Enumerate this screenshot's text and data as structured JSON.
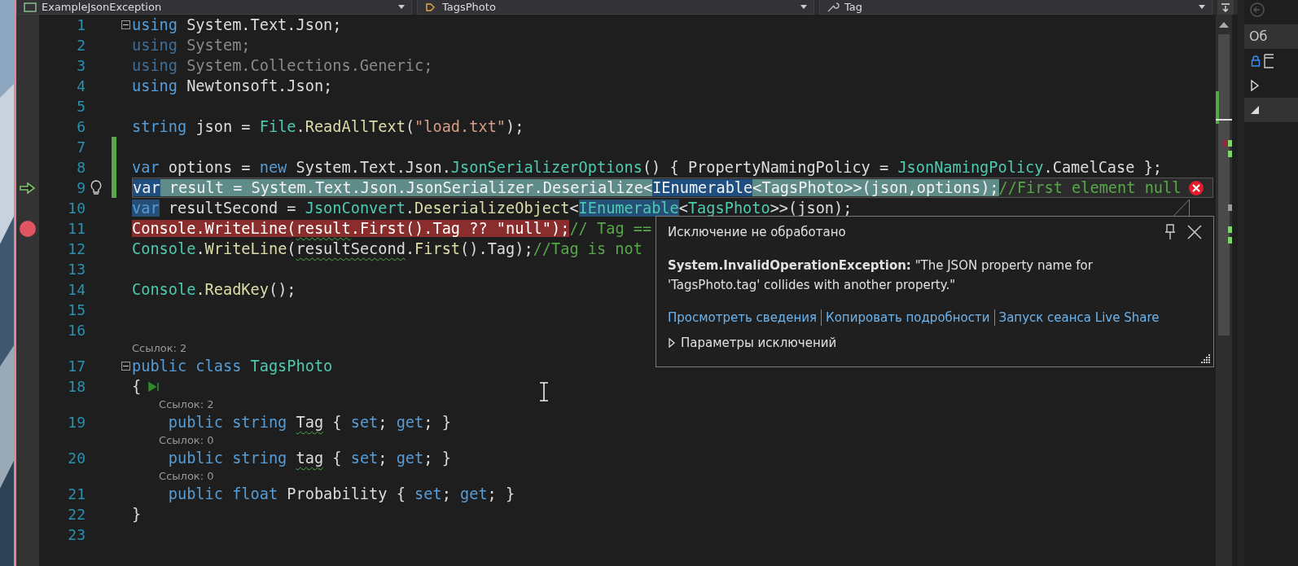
{
  "navigation_bar": [
    {
      "label": "ExampleJsonException",
      "kind": "project"
    },
    {
      "label": "TagsPhoto",
      "kind": "class"
    },
    {
      "label": "Tag",
      "kind": "property"
    }
  ],
  "editor": {
    "lines": [
      {
        "number": "1",
        "collapsible": true,
        "tokens": [
          {
            "t": "using ",
            "kind": "kw"
          },
          {
            "t": "System.Text.Json;",
            "kind": "plain"
          }
        ]
      },
      {
        "number": "2",
        "tokens": [
          {
            "t": "using ",
            "kind": "dimkw"
          },
          {
            "t": "System;",
            "kind": "dim"
          }
        ]
      },
      {
        "number": "3",
        "tokens": [
          {
            "t": "using ",
            "kind": "dimkw"
          },
          {
            "t": "System.Collections.Generic;",
            "kind": "dim"
          }
        ]
      },
      {
        "number": "4",
        "tokens": [
          {
            "t": "using ",
            "kind": "kw"
          },
          {
            "t": "Newtonsoft.Json;",
            "kind": "plain"
          }
        ]
      },
      {
        "number": "5"
      },
      {
        "number": "6",
        "tokens": [
          {
            "t": "string ",
            "kind": "kw"
          },
          {
            "t": "json = ",
            "kind": "plain"
          },
          {
            "t": "File",
            "kind": "type"
          },
          {
            "t": ".",
            "kind": "plain"
          },
          {
            "t": "ReadAllText",
            "kind": "method"
          },
          {
            "t": "(",
            "kind": "plain"
          },
          {
            "t": "\"load.txt\"",
            "kind": "str"
          },
          {
            "t": ");",
            "kind": "plain"
          }
        ]
      },
      {
        "number": "7",
        "changed": true
      },
      {
        "number": "8",
        "changed": true,
        "tokens": [
          {
            "t": "var ",
            "kind": "kw"
          },
          {
            "t": "options = ",
            "kind": "plain"
          },
          {
            "t": "new ",
            "kind": "kw"
          },
          {
            "t": "System.Text.Json.",
            "kind": "plain"
          },
          {
            "t": "JsonSerializerOptions",
            "kind": "type"
          },
          {
            "t": "() { PropertyNamingPolicy = ",
            "kind": "plain"
          },
          {
            "t": "JsonNamingPolicy",
            "kind": "type"
          },
          {
            "t": ".CamelCase };",
            "kind": "plain"
          }
        ]
      },
      {
        "number": "9",
        "current": true,
        "bulb": true,
        "changed": true,
        "error": true,
        "tokens": [
          {
            "t": "var",
            "kind": "kw",
            "selected": true
          },
          {
            "t": " result = System.Text.Json.",
            "kind": "plain"
          },
          {
            "t": "JsonSerializer",
            "kind": "type"
          },
          {
            "t": ".",
            "kind": "plain"
          },
          {
            "t": "Deserialize",
            "kind": "method"
          },
          {
            "t": "<",
            "kind": "plain"
          },
          {
            "t": "IEnumerable",
            "kind": "type",
            "selected": true
          },
          {
            "t": "<",
            "kind": "plain"
          },
          {
            "t": "TagsPhoto",
            "kind": "type"
          },
          {
            "t": ">>(json,options);",
            "kind": "plain"
          },
          {
            "t": "//First element null",
            "kind": "comment"
          }
        ]
      },
      {
        "number": "10",
        "tokens": [
          {
            "t": "var",
            "kind": "kw",
            "selected": true
          },
          {
            "t": " resultSecond = ",
            "kind": "plain"
          },
          {
            "t": "JsonConvert",
            "kind": "type"
          },
          {
            "t": ".",
            "kind": "plain"
          },
          {
            "t": "DeserializeObject",
            "kind": "method"
          },
          {
            "t": "<",
            "kind": "plain"
          },
          {
            "t": "IEnumerable",
            "kind": "type",
            "selected": true
          },
          {
            "t": "<",
            "kind": "plain"
          },
          {
            "t": "TagsPhoto",
            "kind": "type"
          },
          {
            "t": ">>(json);",
            "kind": "plain"
          }
        ]
      },
      {
        "number": "11",
        "breakpoint": true,
        "tokens": [
          {
            "t": "Console",
            "kind": "type"
          },
          {
            "t": ".",
            "kind": "plain"
          },
          {
            "t": "WriteLine",
            "kind": "method"
          },
          {
            "t": "(",
            "kind": "plain"
          },
          {
            "t": "result",
            "kind": "plain",
            "squiggle": true
          },
          {
            "t": ".",
            "kind": "plain"
          },
          {
            "t": "First",
            "kind": "method"
          },
          {
            "t": "().Tag ?? ",
            "kind": "plain"
          },
          {
            "t": "\"null\"",
            "kind": "str"
          },
          {
            "t": ");",
            "kind": "plain"
          },
          {
            "t": "// Tag ==",
            "kind": "comment"
          }
        ]
      },
      {
        "number": "12",
        "tokens": [
          {
            "t": "Console",
            "kind": "type"
          },
          {
            "t": ".",
            "kind": "plain"
          },
          {
            "t": "WriteLine",
            "kind": "method"
          },
          {
            "t": "(",
            "kind": "plain"
          },
          {
            "t": "resultSecond",
            "kind": "plain",
            "squiggle": true
          },
          {
            "t": ".",
            "kind": "plain"
          },
          {
            "t": "First",
            "kind": "method"
          },
          {
            "t": "().Tag);",
            "kind": "plain"
          },
          {
            "t": "//Tag is not",
            "kind": "comment"
          }
        ]
      },
      {
        "number": "13"
      },
      {
        "number": "14",
        "tokens": [
          {
            "t": "Console",
            "kind": "type"
          },
          {
            "t": ".ReadKey",
            "kind": "method"
          },
          {
            "t": "();",
            "kind": "plain"
          }
        ]
      },
      {
        "number": "15"
      },
      {
        "number": "16"
      },
      {
        "number": "17",
        "lens": "Ссылок: 2",
        "collapsible": true,
        "tokens": [
          {
            "t": "public class ",
            "kind": "kw"
          },
          {
            "t": "TagsPhoto",
            "kind": "type"
          }
        ]
      },
      {
        "number": "18",
        "run_marker": true,
        "tokens": [
          {
            "t": "{",
            "kind": "plain"
          }
        ]
      },
      {
        "number": "19",
        "lens": "Ссылок: 2",
        "indented": true,
        "tokens": [
          {
            "t": "public string ",
            "kind": "kw"
          },
          {
            "t": "Tag",
            "kind": "plain",
            "squiggle": true
          },
          {
            "t": " { ",
            "kind": "plain"
          },
          {
            "t": "set",
            "kind": "kw"
          },
          {
            "t": "; ",
            "kind": "plain"
          },
          {
            "t": "get",
            "kind": "kw"
          },
          {
            "t": "; }",
            "kind": "plain"
          }
        ]
      },
      {
        "number": "20",
        "lens": "Ссылок: 0",
        "indented": true,
        "tokens": [
          {
            "t": "public string ",
            "kind": "kw"
          },
          {
            "t": "tag",
            "kind": "plain",
            "squiggle": true
          },
          {
            "t": " { ",
            "kind": "plain"
          },
          {
            "t": "set",
            "kind": "kw"
          },
          {
            "t": "; ",
            "kind": "plain"
          },
          {
            "t": "get",
            "kind": "kw"
          },
          {
            "t": "; }",
            "kind": "plain"
          }
        ]
      },
      {
        "number": "21",
        "lens": "Ссылок: 0",
        "indented": true,
        "tokens": [
          {
            "t": "public float ",
            "kind": "kw"
          },
          {
            "t": "Probability { ",
            "kind": "plain"
          },
          {
            "t": "set",
            "kind": "kw"
          },
          {
            "t": "; ",
            "kind": "plain"
          },
          {
            "t": "get",
            "kind": "kw"
          },
          {
            "t": "; }",
            "kind": "plain"
          }
        ]
      },
      {
        "number": "22",
        "tokens": [
          {
            "t": "}",
            "kind": "plain"
          }
        ]
      },
      {
        "number": "23"
      }
    ]
  },
  "exception_popup": {
    "title": "Исключение не обработано",
    "message": "**System.InvalidOperationException:** \"The JSON property name for 'TagsPhoto.tag' collides with another property.\"",
    "links": [
      "Просмотреть сведения",
      "Копировать подробности",
      "Запуск сеанса Live Share"
    ],
    "settings": {
      "label": "Параметры исключений",
      "expanded": false
    }
  },
  "side_panel": {
    "tab_label": "Об"
  }
}
